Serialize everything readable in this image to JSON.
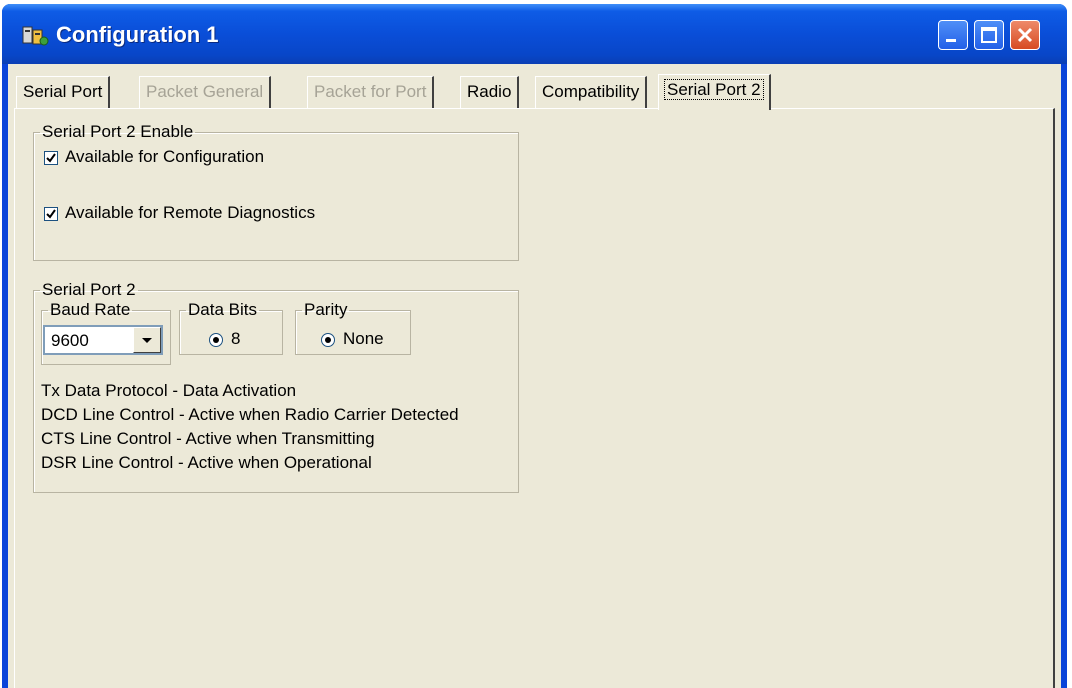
{
  "window": {
    "title": "Configuration 1"
  },
  "tabs": [
    {
      "label": "Serial Port",
      "state": "enabled"
    },
    {
      "label": "Packet General",
      "state": "disabled"
    },
    {
      "label": "Packet for Port",
      "state": "disabled"
    },
    {
      "label": "Radio",
      "state": "enabled"
    },
    {
      "label": "Compatibility",
      "state": "enabled"
    },
    {
      "label": "Serial Port 2",
      "state": "active"
    }
  ],
  "enable_group": {
    "legend": "Serial Port 2 Enable",
    "available_for_configuration": {
      "label": "Available for Configuration",
      "checked": true
    },
    "available_for_remote_diagnostics": {
      "label": "Available for Remote Diagnostics",
      "checked": true
    }
  },
  "serial_port_group": {
    "legend": "Serial Port 2",
    "baud_rate": {
      "legend": "Baud Rate",
      "value": "9600"
    },
    "data_bits": {
      "legend": "Data Bits",
      "option": "8",
      "selected": true
    },
    "parity": {
      "legend": "Parity",
      "option": "None",
      "selected": true
    },
    "info_lines": [
      "Tx Data Protocol - Data Activation",
      "DCD Line Control - Active when Radio Carrier Detected",
      "CTS Line Control - Active when Transmitting",
      "DSR Line Control - Active when Operational"
    ]
  },
  "colors": {
    "titlebar": "#0a4ed8",
    "dialog_bg": "#ece9d8",
    "close_button": "#d74b22"
  },
  "icons": [
    "app-icon",
    "minimize-icon",
    "maximize-icon",
    "close-icon",
    "checkmark-icon",
    "dropdown-arrow-icon"
  ]
}
